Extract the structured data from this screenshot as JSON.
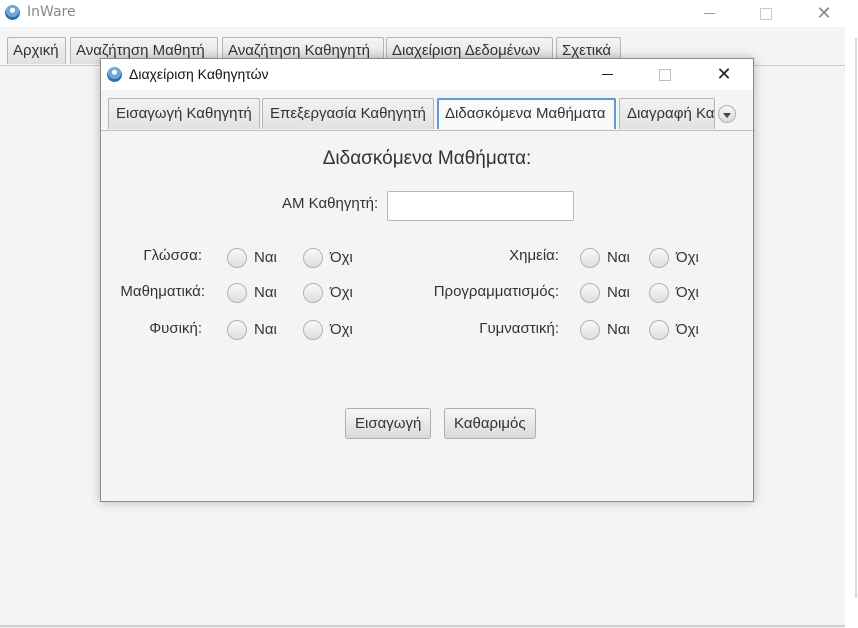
{
  "main_window": {
    "title": "InWare",
    "tabs": [
      {
        "label": "Αρχική"
      },
      {
        "label": "Αναζήτηση Μαθητή"
      },
      {
        "label": "Αναζήτηση Καθηγητή"
      },
      {
        "label": "Διαχείριση Δεδομένων"
      },
      {
        "label": "Σχετικά"
      }
    ]
  },
  "dialog": {
    "title": "Διαχείριση Καθηγητών",
    "tabs": [
      {
        "label": "Εισαγωγή Καθηγητή"
      },
      {
        "label": "Επεξεργασία Καθηγητή"
      },
      {
        "label": "Διδασκόμενα Μαθήματα"
      },
      {
        "label": "Διαγραφή Κα"
      }
    ],
    "active_tab_index": 2,
    "heading": "Διδασκόμενα Μαθήματα:",
    "am_label": "ΑΜ Καθηγητή:",
    "am_value": "",
    "yes_label": "Ναι",
    "no_label": "Όχι",
    "subjects_left": [
      {
        "label": "Γλώσσα:"
      },
      {
        "label": "Μαθηματικά:"
      },
      {
        "label": "Φυσική:"
      }
    ],
    "subjects_right": [
      {
        "label": "Χημεία:"
      },
      {
        "label": "Προγραμματισμός:"
      },
      {
        "label": "Γυμναστική:"
      }
    ],
    "buttons": {
      "insert": "Εισαγωγή",
      "clear": "Καθαριμός"
    }
  },
  "icons": {
    "app": "app-logo-icon",
    "minimize": "minimize-icon",
    "maximize": "maximize-icon",
    "close": "close-icon",
    "tab_overflow": "chevron-down-icon"
  },
  "colors": {
    "active_tab_border": "#5d9cd6",
    "window_bg": "#f4f4f4"
  }
}
